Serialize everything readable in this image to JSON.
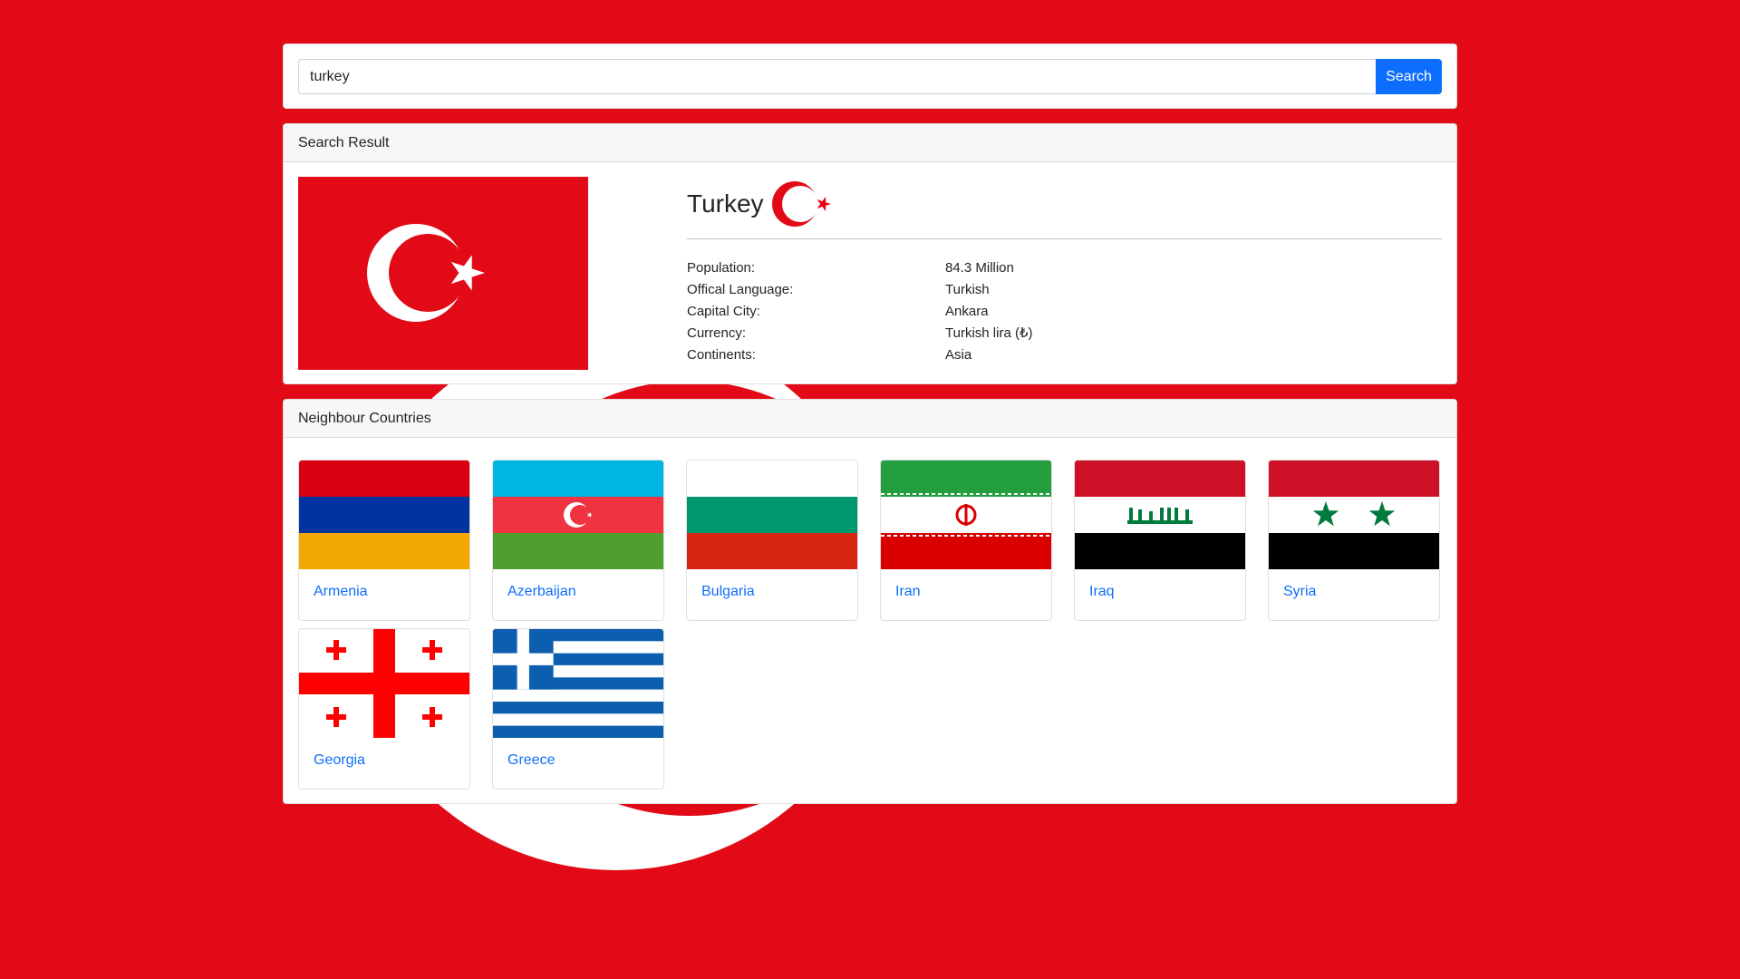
{
  "search": {
    "value": "turkey",
    "button_label": "Search"
  },
  "result": {
    "header": "Search Result",
    "country": "Turkey",
    "facts": [
      {
        "label": "Population:",
        "value": "84.3 Million"
      },
      {
        "label": "Offical Language:",
        "value": "Turkish"
      },
      {
        "label": "Capital City:",
        "value": "Ankara"
      },
      {
        "label": "Currency:",
        "value": "Turkish lira (₺)"
      },
      {
        "label": "Continents:",
        "value": "Asia"
      }
    ]
  },
  "neighbours": {
    "header": "Neighbour Countries",
    "items": [
      {
        "name": "Armenia",
        "icon": "armenia-flag-icon"
      },
      {
        "name": "Azerbaijan",
        "icon": "azerbaijan-flag-icon"
      },
      {
        "name": "Bulgaria",
        "icon": "bulgaria-flag-icon"
      },
      {
        "name": "Iran",
        "icon": "iran-flag-icon"
      },
      {
        "name": "Iraq",
        "icon": "iraq-flag-icon"
      },
      {
        "name": "Syria",
        "icon": "syria-flag-icon"
      },
      {
        "name": "Georgia",
        "icon": "georgia-flag-icon"
      },
      {
        "name": "Greece",
        "icon": "greece-flag-icon"
      }
    ]
  },
  "colors": {
    "background": "#e30a17",
    "primary": "#0d6efd",
    "card_header": "#f7f7f7"
  }
}
